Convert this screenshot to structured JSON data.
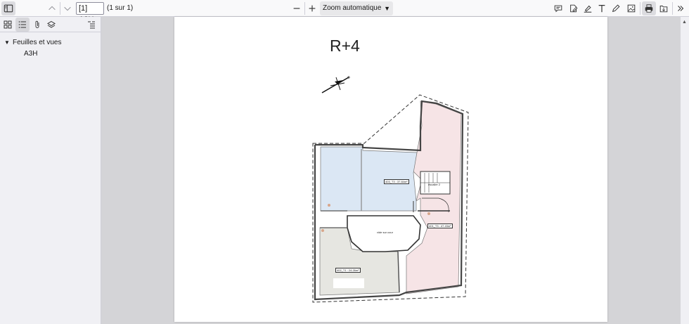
{
  "toolbar": {
    "page_input_value": "[1] A3H",
    "page_count": "(1 sur 1)",
    "zoom_value": "Zoom automatique",
    "zoom_out_icon": "minus-icon",
    "zoom_in_icon": "plus-icon"
  },
  "sidebar": {
    "tabs": [
      "thumbnails-icon",
      "outline-icon",
      "attachments-icon",
      "layers-icon"
    ],
    "tree": {
      "parent_label": "Feuilles et vues",
      "children": [
        {
          "label": "A3H"
        }
      ]
    }
  },
  "document": {
    "title": "R+4",
    "rooms": [
      {
        "label": "403_T3 : 37.84m²",
        "fill": "#dbe7f4"
      },
      {
        "label": "401_T3 : 47.43m²",
        "fill": "#f6e4e6"
      },
      {
        "label": "402_T1 : 24.26m²",
        "fill": "#e6e6e1"
      }
    ],
    "annotations": {
      "void": "vide sur cour",
      "stair": "escalier 2"
    }
  },
  "colors": {
    "toolbar_bg": "#f9f9fa",
    "sidebar_bg": "#f0f0f4",
    "viewer_bg": "#d4d4d7"
  }
}
